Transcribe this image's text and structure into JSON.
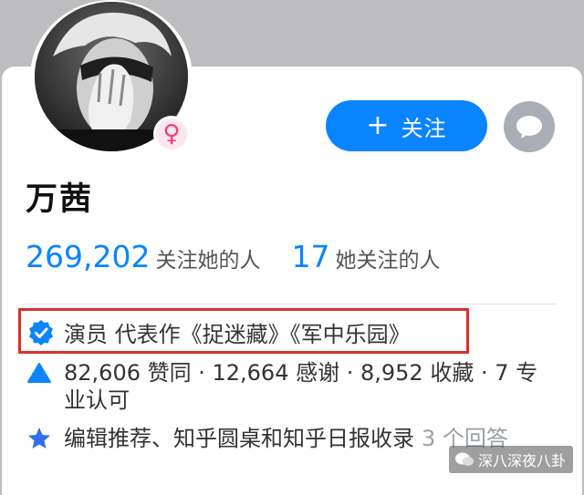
{
  "profile": {
    "name": "万茜",
    "gender_symbol": "♀",
    "follow_button": {
      "icon": "plus-icon",
      "plus": "+",
      "label": "关注"
    },
    "message_button": {
      "icon": "chat-bubble-icon"
    },
    "stats": {
      "followers_count": "269,202",
      "followers_label": "关注她的人",
      "following_count": "17",
      "following_label": "她关注的人"
    },
    "verification": {
      "icon": "verified-badge-icon",
      "text": "演员 代表作《捉迷藏》《军中乐园》"
    },
    "achievements": {
      "icon": "triangle-icon",
      "text": "82,606 赞同 · 12,664 感谢 · 8,952 收藏 · 7 专业认可"
    },
    "recommendation": {
      "icon": "star-icon",
      "text": "编辑推荐、知乎圆桌和知乎日报收录",
      "answers": "3 个回答"
    }
  },
  "watermark": {
    "text": "深八深夜八卦",
    "icon": "wechat-icon"
  },
  "colors": {
    "accent": "#0a84ff",
    "female": "#f1407a",
    "highlight_box": "#d9302c",
    "background": "#bdbdbf"
  }
}
